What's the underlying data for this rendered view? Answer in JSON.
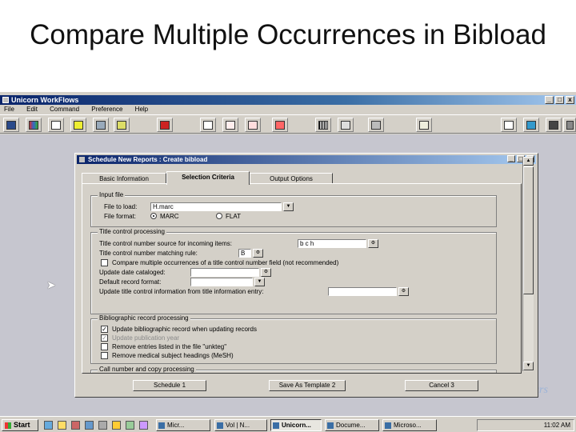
{
  "slide": {
    "title": "Compare Multiple Occurrences in Bibload"
  },
  "app": {
    "title": "Unicorn WorkFlows",
    "window_buttons": [
      "_",
      "□",
      "x"
    ],
    "menu": [
      "File",
      "Edit",
      "Command",
      "Preference",
      "Help"
    ],
    "toolbar_icons": [
      "user-icon",
      "books-icon",
      "book-open-icon",
      "library-icon",
      "shelf-icon",
      "wand-icon",
      "transfer-icon",
      "copy-icon",
      "edit-icon",
      "check-icon",
      "cancel-icon",
      "barcode-icon",
      "bill-icon",
      "tools-icon",
      "reports-icon",
      "home-icon",
      "save-icon",
      "binoculars-icon",
      "exit-icon"
    ]
  },
  "dialog": {
    "title": "Schedule New Reports : Create bibload",
    "window_buttons": [
      "_",
      "□",
      "x"
    ],
    "tabs": [
      {
        "label": "Basic Information",
        "active": false
      },
      {
        "label": "Selection Criteria",
        "active": true
      },
      {
        "label": "Output Options",
        "active": false
      }
    ],
    "input_file": {
      "group_label": "Input file",
      "file_to_load_label": "File to load:",
      "file_to_load_value": "H.marc",
      "file_format_label": "File format:",
      "format_marc": "MARC",
      "format_flat": "FLAT",
      "selected_format": "MARC"
    },
    "title_control": {
      "group_label": "Title control processing",
      "source_label": "Title control number source for incoming items:",
      "source_value": "b c h",
      "matching_rule_label": "Title control number matching rule:",
      "matching_rule_value": "B",
      "compare_label": "Compare multiple occurrences of a title control number field (not recommended)",
      "compare_checked": false,
      "update_date_label": "Update date cataloged:",
      "update_date_value": "",
      "default_format_label": "Default record format:",
      "default_format_value": "",
      "update_info_label": "Update title control information from title information entry:",
      "update_info_value": ""
    },
    "bib_processing": {
      "group_label": "Bibliographic record processing",
      "items": [
        {
          "label": "Update bibliographic record when updating records",
          "checked": true,
          "enabled": true
        },
        {
          "label": "Update publication year",
          "checked": true,
          "enabled": false
        },
        {
          "label": "Remove entries listed in the file \"unkteg\"",
          "checked": false,
          "enabled": true
        },
        {
          "label": "Remove medical subject headings (MeSH)",
          "checked": false,
          "enabled": true
        }
      ]
    },
    "call_number": {
      "group_label": "Call number and copy processing"
    },
    "buttons": {
      "schedule": "Schedule 1",
      "save_template": "Save As Template 2",
      "cancel": "Cancel 3"
    }
  },
  "taskbar": {
    "start_label": "Start",
    "tasks": [
      {
        "label": "Micr...",
        "active": false
      },
      {
        "label": "Vol | N...",
        "active": false
      },
      {
        "label": "Unicorn...",
        "active": true
      },
      {
        "label": "Docume...",
        "active": false
      },
      {
        "label": "Microso...",
        "active": false
      }
    ],
    "clock": "11:02 AM"
  },
  "watermark": "ours"
}
